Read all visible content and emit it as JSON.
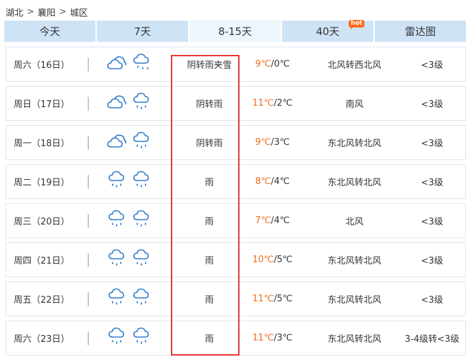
{
  "breadcrumb": {
    "items": [
      "湖北",
      "襄阳",
      "城区"
    ],
    "separator": ">"
  },
  "tabs": [
    {
      "label": "今天"
    },
    {
      "label": "7天"
    },
    {
      "label": "8-15天"
    },
    {
      "label": "40天",
      "badge": "hot"
    },
    {
      "label": "雷达图"
    }
  ],
  "active_tab": "8-15天",
  "colors": {
    "high_temp": "#f46b1a",
    "tab_bg": "#cfe3f7",
    "active_tab_bg": "#eef6fd",
    "highlight_border": "#e53333",
    "hot_badge": "#ff6a1a"
  },
  "forecast": [
    {
      "day": "周六（16日）",
      "icons": [
        "cloudy-icon",
        "rain-snow-icon"
      ],
      "desc": "阴转雨夹雪",
      "high": "9℃",
      "low": "0℃",
      "wind": "北风转西北风",
      "level": "<3级"
    },
    {
      "day": "周日（17日）",
      "icons": [
        "cloudy-icon",
        "rain-icon"
      ],
      "desc": "阴转雨",
      "high": "11℃",
      "low": "2℃",
      "wind": "南风",
      "level": "<3级"
    },
    {
      "day": "周一（18日）",
      "icons": [
        "cloudy-icon",
        "rain-icon"
      ],
      "desc": "阴转雨",
      "high": "9℃",
      "low": "3℃",
      "wind": "东北风转北风",
      "level": "<3级"
    },
    {
      "day": "周二（19日）",
      "icons": [
        "rain-icon",
        "rain-icon"
      ],
      "desc": "雨",
      "high": "8℃",
      "low": "4℃",
      "wind": "东北风转北风",
      "level": "<3级"
    },
    {
      "day": "周三（20日）",
      "icons": [
        "rain-icon",
        "rain-icon"
      ],
      "desc": "雨",
      "high": "7℃",
      "low": "4℃",
      "wind": "北风",
      "level": "<3级"
    },
    {
      "day": "周四（21日）",
      "icons": [
        "rain-icon",
        "rain-icon"
      ],
      "desc": "雨",
      "high": "10℃",
      "low": "5℃",
      "wind": "东北风转北风",
      "level": "<3级"
    },
    {
      "day": "周五（22日）",
      "icons": [
        "rain-icon",
        "rain-icon"
      ],
      "desc": "雨",
      "high": "11℃",
      "low": "5℃",
      "wind": "东北风转北风",
      "level": "<3级"
    },
    {
      "day": "周六（23日）",
      "icons": [
        "rain-icon",
        "rain-icon"
      ],
      "desc": "雨",
      "high": "11℃",
      "low": "3℃",
      "wind": "东北风转北风",
      "level": "3-4级转<3级"
    }
  ]
}
